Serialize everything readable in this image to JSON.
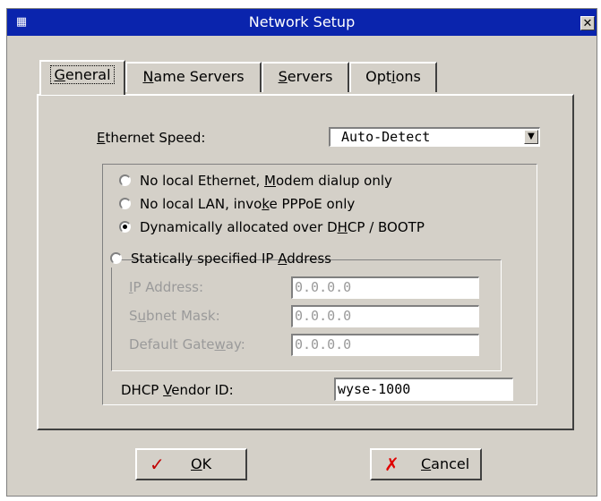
{
  "window": {
    "title": "Network Setup",
    "close_glyph": "✕",
    "app_icon": "network-app-icon"
  },
  "tabs": [
    {
      "label": "General",
      "mnemonic": "G",
      "active": true
    },
    {
      "label": "Name Servers",
      "mnemonic": "N",
      "active": false
    },
    {
      "label": "Servers",
      "mnemonic": "S",
      "active": false
    },
    {
      "label": "Options",
      "mnemonic": "i",
      "active": false
    }
  ],
  "general": {
    "ethernet_speed_label": "Ethernet Speed:",
    "ethernet_speed_value": "Auto-Detect",
    "radio_options": [
      {
        "label": "No local Ethernet, Modem dialup only",
        "selected": false
      },
      {
        "label": "No local LAN, invoke PPPoE only",
        "selected": false
      },
      {
        "label": "Dynamically allocated over DHCP / BOOTP",
        "selected": true
      },
      {
        "label": "Statically specified IP Address",
        "selected": false
      }
    ],
    "ip_address_label": "IP Address:",
    "ip_address_value": "0.0.0.0",
    "subnet_mask_label": "Subnet Mask:",
    "subnet_mask_value": "0.0.0.0",
    "default_gateway_label": "Default Gateway:",
    "default_gateway_value": "0.0.0.0",
    "dhcp_vendor_label": "DHCP Vendor ID:",
    "dhcp_vendor_value": "wyse-1000"
  },
  "buttons": {
    "ok_label": "OK",
    "cancel_label": "Cancel",
    "ok_icon": "checkmark-icon",
    "cancel_icon": "x-icon",
    "ok_icon_color": "#c00000",
    "cancel_icon_color": "#e00000"
  }
}
